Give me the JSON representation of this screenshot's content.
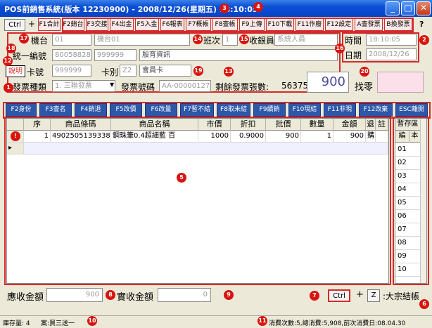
{
  "window": {
    "title": "POS前銷售系統(版本 12230900) - 2008/12/26(星期五) 18:10:05",
    "minimize": "_",
    "maximize": "□",
    "close": "✕"
  },
  "markers": [
    "1",
    "2",
    "3",
    "4",
    "5",
    "6",
    "7",
    "8",
    "9",
    "10",
    "11",
    "12",
    "13",
    "14",
    "15",
    "16",
    "17",
    "18",
    "19",
    "20"
  ],
  "topbar": {
    "ctrl_label": "Ctrl",
    "plus": "+",
    "fkeys": [
      "F1合計",
      "F2銷台",
      "F3交接",
      "F4出金",
      "F5入金",
      "F6報表",
      "F7概帳",
      "F8查帳",
      "F9上傳",
      "F10下載",
      "F11作廢",
      "F12設定",
      "A查發票",
      "B換發票"
    ],
    "help": "?"
  },
  "form": {
    "machine_label": "機台",
    "machine_value": "01",
    "machine_name": "機台01",
    "shift_label": "班次",
    "shift_value": "1",
    "cashier_label": "收銀員",
    "cashier_value": "系統人員",
    "time_label": "時間",
    "time_value": "18:10:05",
    "date_label": "日期",
    "date_value": "2008/12/26",
    "tax_id_label": "統一編號",
    "tax_id_1": "80058828",
    "tax_id_2": "999999",
    "company": "殷育資訊",
    "explain_btn": "說明",
    "card_no_label": "卡號",
    "card_no_value": "999999",
    "card_type_label": "卡別",
    "card_type_value": "Z2",
    "card_type_name": "會員卡",
    "invoice_type_label": "發票種類",
    "invoice_type_value": "1. 三聯發票",
    "invoice_no_label": "發票號碼",
    "invoice_no_value": "AA-00000127",
    "remaining_label": "剩餘發票張數:",
    "remaining_value": "563751",
    "change_amount": "900",
    "change_label": "找零"
  },
  "function_buttons": [
    "F2身份",
    "F3查名",
    "F4銷退",
    "F5改價",
    "F6改量",
    "F7暫不結",
    "F8取未結",
    "F9續銷",
    "F10現結",
    "F11非現",
    "F12改棄",
    "ESC離開"
  ],
  "grid": {
    "headers": [
      "序",
      "商品條碼",
      "商品名稱",
      "市價",
      "折扣",
      "批價",
      "數量",
      "金額",
      "退",
      "註"
    ],
    "rows": [
      {
        "seq": "1",
        "barcode": "4902505139338",
        "name": "鋼珠筆0.4超細藍 百",
        "price": "1000",
        "discount": "0.9000",
        "net": "900",
        "qty": "1",
        "amount": "900",
        "ret": "購",
        "note": ""
      }
    ]
  },
  "side_grid": {
    "title": "暫存區",
    "col1": "編",
    "col2": "本",
    "items": [
      "01",
      "02",
      "03",
      "04",
      "05",
      "06",
      "07",
      "08",
      "09",
      "10"
    ]
  },
  "bottom": {
    "receivable_label": "應收金額",
    "receivable_value": "900",
    "received_label": "實收金額",
    "received_value": "0",
    "ctrl_label": "Ctrl",
    "plus": "+",
    "z_label": "Z",
    "bulk_label": ":大宗結帳"
  },
  "status": {
    "stock": "庫存量: 4",
    "promo": "案:買三送一",
    "sales": "消費次數:5,總消費:5,908,前次消費日:08.04.30"
  }
}
